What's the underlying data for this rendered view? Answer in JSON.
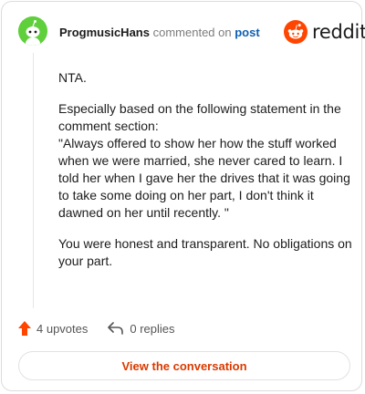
{
  "header": {
    "username": "ProgmusicHans",
    "action_text": "commented on",
    "post_link": "post"
  },
  "brand": {
    "logo_text": "reddit",
    "logo_icon": "reddit-snoo-icon",
    "accent": "#ff4500"
  },
  "comment": {
    "paragraphs": [
      "NTA.",
      "Especially based on the following statement in the comment section:",
      "\"Always offered to show her how the stuff worked when we were married, she never cared to learn. I told her when I gave her the drives that it was going to take some doing on her part, I don't think it dawned on her until recently. \"",
      "You were honest and transparent. No obligations on your part."
    ]
  },
  "actions": {
    "upvotes_label": "4 upvotes",
    "upvote_icon": "upvote-arrow-icon",
    "replies_label": "0 replies",
    "reply_icon": "reply-arrow-icon"
  },
  "cta": {
    "label": "View the conversation",
    "color": "#d93a00"
  },
  "avatar": {
    "icon": "snoo-avatar-icon",
    "color": "#5fcf3c"
  }
}
